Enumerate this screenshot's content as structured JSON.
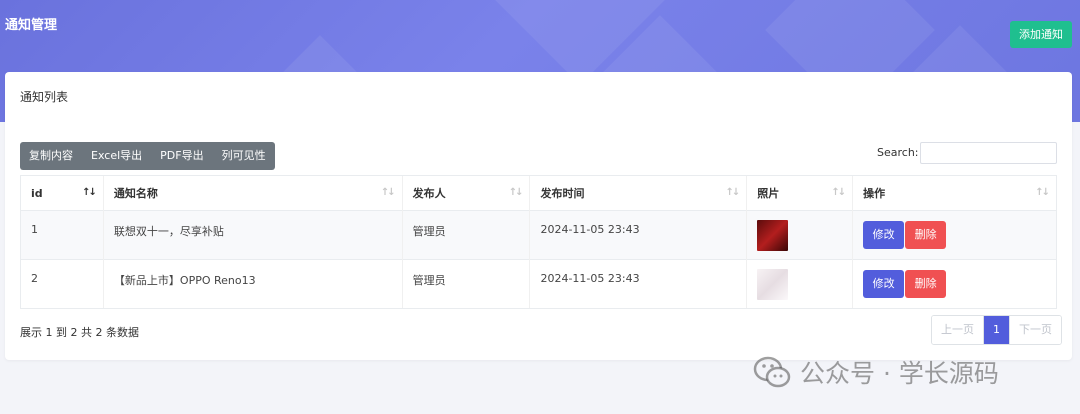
{
  "header": {
    "title": "通知管理",
    "add_button": "添加通知",
    "accent_color": "#6a72dd",
    "add_button_color": "#1fbf8f"
  },
  "card": {
    "title": "通知列表"
  },
  "toolbar": {
    "buttons": [
      "复制内容",
      "Excel导出",
      "PDF导出",
      "列可见性"
    ]
  },
  "search": {
    "label": "Search:",
    "value": ""
  },
  "table": {
    "columns": [
      "id",
      "通知名称",
      "发布人",
      "发布时间",
      "照片",
      "操作"
    ],
    "rows": [
      {
        "id": "1",
        "name": "联想双十一，尽享补贴",
        "publisher": "管理员",
        "time": "2024-11-05 23:43",
        "photo": "red-product-image"
      },
      {
        "id": "2",
        "name": "【新品上市】OPPO Reno13",
        "publisher": "管理员",
        "time": "2024-11-05 23:43",
        "photo": "light-product-image"
      }
    ],
    "edit_label": "修改",
    "delete_label": "删除",
    "edit_color": "#525ddc",
    "delete_color": "#f05052"
  },
  "footer": {
    "info": "展示 1 到 2 共 2 条数据",
    "prev": "上一页",
    "page": "1",
    "next": "下一页"
  },
  "watermark": {
    "text": "公众号 · 学长源码"
  }
}
